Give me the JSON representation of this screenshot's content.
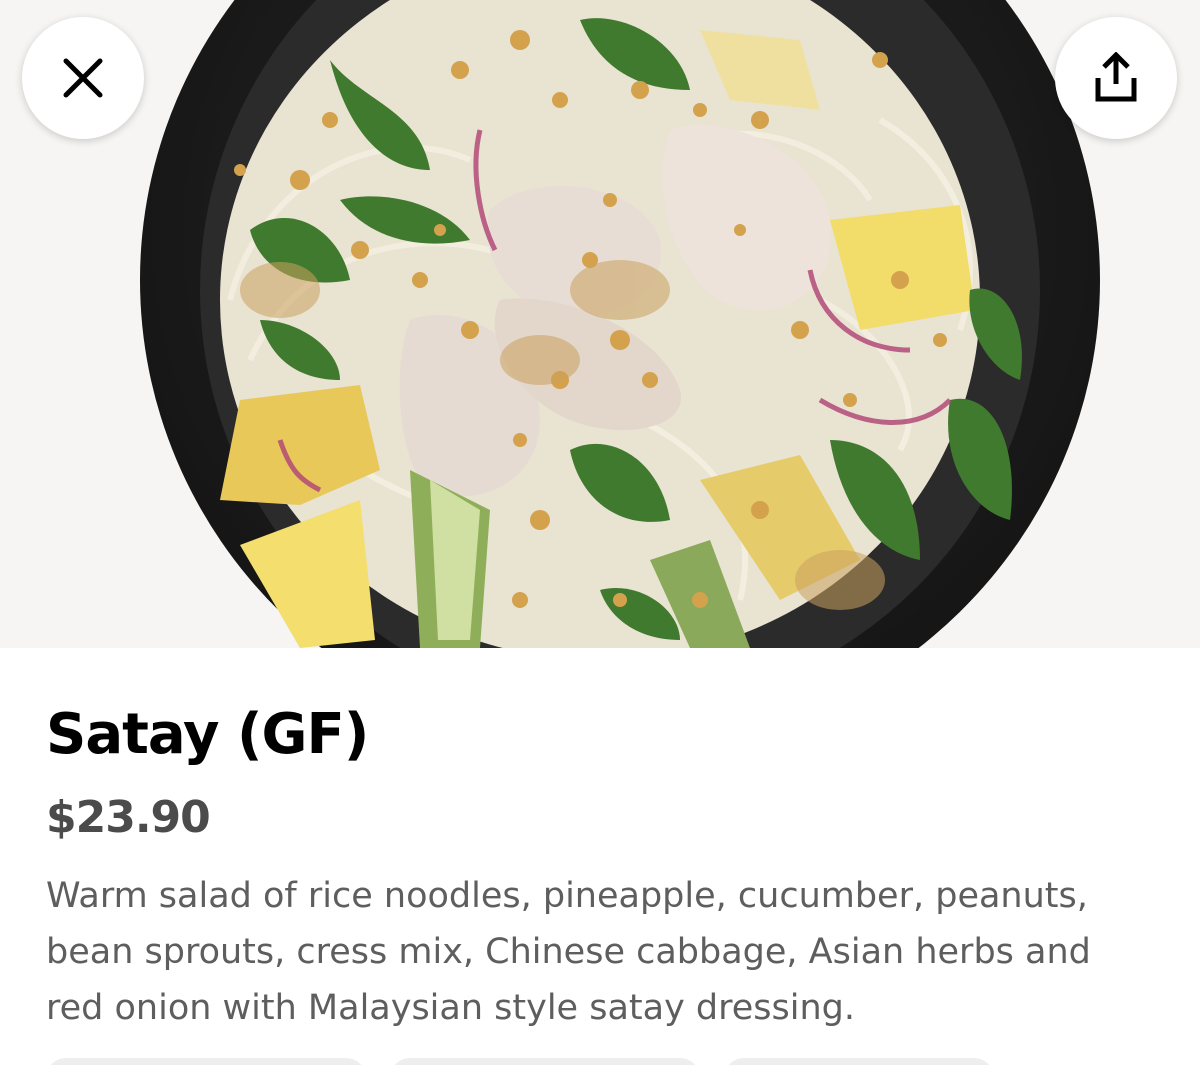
{
  "hero": {
    "image_alt": "satay-salad-photo"
  },
  "toolbar": {
    "close_icon": "close-icon",
    "share_icon": "share-icon"
  },
  "item": {
    "title": "Satay (GF)",
    "price": "$23.90",
    "description": "Warm salad of rice noodles, pineapple, cucumber, peanuts, bean sprouts, cress mix, Chinese cabbage, Asian herbs and red onion with Malaysian style satay dressing."
  },
  "colors": {
    "title": "#000000",
    "price": "#4b4b4b",
    "description": "#5e5e5e",
    "bowl": "#1f1f1f"
  }
}
